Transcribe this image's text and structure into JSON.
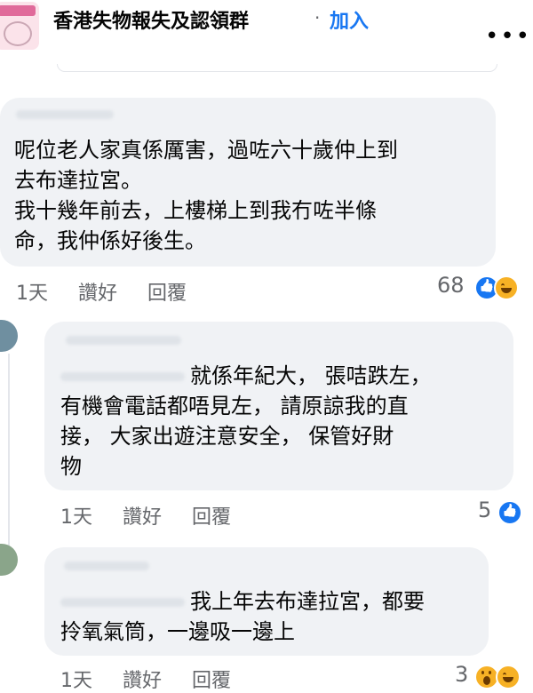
{
  "header": {
    "group_name": "香港失物報失及認領群",
    "separator": "·",
    "join_label": "加入",
    "more_label": "•••"
  },
  "comments": [
    {
      "lines": [
        "呢位老人家真係厲害，過咗六十歲仲上到",
        "去布達拉宮。",
        "我十幾年前去，上樓梯上到我冇咗半條",
        "命，我仲係好後生。"
      ],
      "time": "1天",
      "like_label": "讚好",
      "reply_label": "回覆",
      "reaction_count": "68",
      "reactions": [
        "like-icon",
        "haha-icon"
      ]
    },
    {
      "mention_tail": "就係年紀大，",
      "mention_tail2": " 張咭跌左，",
      "lines": [
        "有機會電話都唔見左，  請原諒我的直",
        "接，  大家出遊注意安全，  保管好財",
        "物"
      ],
      "time": "1天",
      "like_label": "讚好",
      "reply_label": "回覆",
      "reaction_count": "5",
      "reactions": [
        "like-icon"
      ]
    },
    {
      "mention_tail": "我上年去布達拉宮，都要",
      "lines": [
        "拎氧氣筒，一邊吸一邊上"
      ],
      "time": "1天",
      "like_label": "讚好",
      "reply_label": "回覆",
      "reaction_count": "3",
      "reactions": [
        "wow-icon",
        "haha-icon"
      ]
    }
  ],
  "colors": {
    "link_blue": "#1877f2",
    "bubble_bg": "#f0f2f5",
    "meta_grey": "#65676b"
  }
}
